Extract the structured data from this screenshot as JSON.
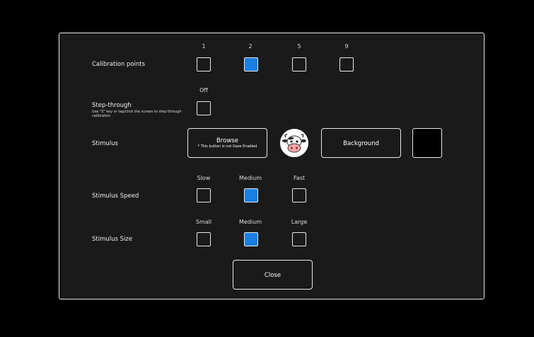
{
  "calibration": {
    "label": "Calibration points",
    "options": [
      "1",
      "2",
      "5",
      "9"
    ],
    "selected": "2"
  },
  "step_through": {
    "label": "Step-through",
    "description": "Use \"S\" key or tap/click the screen to step through calibration",
    "option": "Off"
  },
  "stimulus": {
    "label": "Stimulus",
    "browse_label": "Browse",
    "browse_note": "* This button is not Gaze Enabled",
    "stimulus_icon": "cow-face-icon",
    "background_label": "Background",
    "background_color": "#000000"
  },
  "speed": {
    "label": "Stimulus Speed",
    "options": [
      "Slow",
      "Medium",
      "Fast"
    ],
    "selected": "Medium"
  },
  "size": {
    "label": "Stimulus Size",
    "options": [
      "Small",
      "Medium",
      "Large"
    ],
    "selected": "Medium"
  },
  "close_label": "Close",
  "colors": {
    "selected": "#1a7fe0",
    "background": "#000000",
    "panel": "#1a1a1a"
  }
}
